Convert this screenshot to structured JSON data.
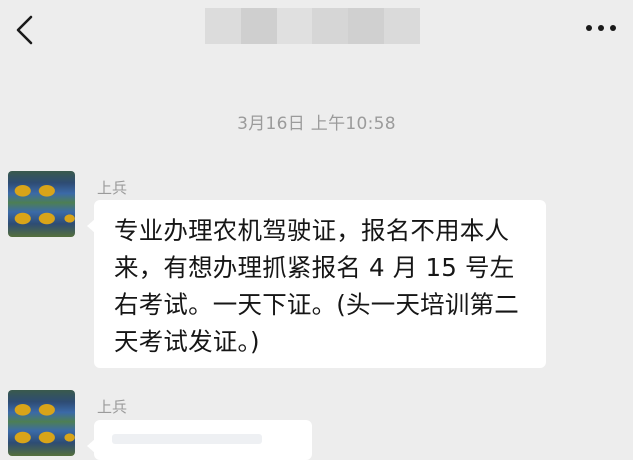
{
  "header": {
    "back_icon": "chevron-left-icon",
    "more_icon": "more-dots-icon",
    "title_blur_colors": [
      "#dcdcdc",
      "#cfcfcf",
      "#e0e0e0",
      "#d6d6d6",
      "#d0d0d0",
      "#dadada"
    ]
  },
  "chat": {
    "timestamp": "3月16日 上午10:58",
    "messages": [
      {
        "sender": "上兵",
        "text": "专业办理农机驾驶证，报名不用本人来，有想办理抓紧报名 4 月 15 号左右考试。一天下证。(头一天培训第二天考试发证。)"
      },
      {
        "sender": "上兵",
        "text": ""
      }
    ]
  },
  "colors": {
    "background": "#ededed",
    "bubble": "#ffffff",
    "meta_text": "#9b9b9b",
    "body_text": "#161616"
  }
}
